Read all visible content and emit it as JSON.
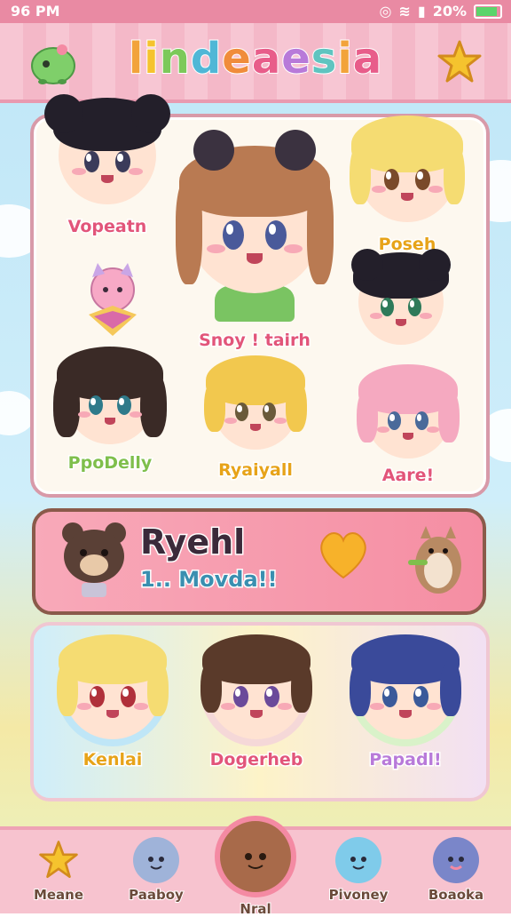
{
  "status_bar": {
    "time": "96 PM",
    "battery": "20%"
  },
  "header": {
    "title_letters": [
      {
        "ch": "l",
        "color": "#f2a33a"
      },
      {
        "ch": "i",
        "color": "#f5c32e"
      },
      {
        "ch": "n",
        "color": "#7cc95a"
      },
      {
        "ch": "d",
        "color": "#4fb7d6"
      },
      {
        "ch": "e",
        "color": "#f08c3b"
      },
      {
        "ch": "a",
        "color": "#e85d8a"
      },
      {
        "ch": "e",
        "color": "#b87ad9"
      },
      {
        "ch": "s",
        "color": "#5fc4c0"
      },
      {
        "ch": "i",
        "color": "#f2a33a"
      },
      {
        "ch": "a",
        "color": "#e85d8a"
      }
    ]
  },
  "gallery": {
    "characters": [
      {
        "label": "Vopeatn",
        "color": "#e2557a"
      },
      {
        "label": "Snoy ! tairh",
        "color": "#e2557a"
      },
      {
        "label": "Poseh",
        "color": "#e7a319"
      },
      {
        "label": "PpoDelly",
        "color": "#7fbf4c"
      },
      {
        "label": "Ryaiyall",
        "color": "#e7a319"
      },
      {
        "label": "Aare!",
        "color": "#e2557a"
      }
    ]
  },
  "feature": {
    "title": "Ryehl",
    "subtitle": "1.. Movda!!"
  },
  "friends": [
    {
      "label": "Kenlai",
      "color": "#e7a319"
    },
    {
      "label": "Dogerheb",
      "color": "#e2557a"
    },
    {
      "label": "Papadl!",
      "color": "#b87ad9"
    }
  ],
  "nav": [
    {
      "label": "Meane",
      "icon": "star-icon"
    },
    {
      "label": "Paaboy",
      "icon": "pet-icon"
    },
    {
      "label": "Nral",
      "icon": "avatar-icon"
    },
    {
      "label": "Pivoney",
      "icon": "bubble-icon"
    },
    {
      "label": "Boaoka",
      "icon": "bear-icon"
    }
  ],
  "colors": {
    "accent_pink": "#f48aa3",
    "header_pink": "#f7c3cf",
    "gold": "#f5c32e"
  }
}
